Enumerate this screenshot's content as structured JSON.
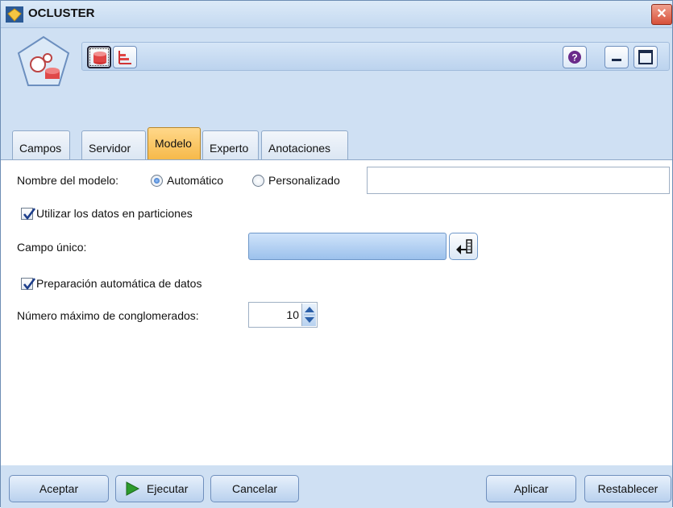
{
  "window": {
    "title": "OCLUSTER",
    "close_label": "✕"
  },
  "toolbar": {
    "buttons": [
      {
        "name": "data-source-icon",
        "selected": true
      },
      {
        "name": "chart-icon",
        "selected": false
      }
    ],
    "help_label": "?",
    "minimize_label": "",
    "maximize_label": ""
  },
  "tabs": [
    {
      "label": "Campos",
      "active": false
    },
    {
      "label": "Servidor",
      "active": false
    },
    {
      "label": "Modelo",
      "active": true
    },
    {
      "label": "Experto",
      "active": false
    },
    {
      "label": "Anotaciones",
      "active": false
    }
  ],
  "form": {
    "model_name_label": "Nombre del modelo:",
    "radio_auto": "Automático",
    "radio_custom": "Personalizado",
    "custom_name_value": "",
    "use_partitions_label": "Utilizar los datos en particiones",
    "unique_field_label": "Campo único:",
    "unique_field_value": "",
    "auto_prep_label": "Preparación automática de datos",
    "max_clusters_label": "Número máximo de conglomerados:",
    "max_clusters_value": "10"
  },
  "footer": {
    "accept": "Aceptar",
    "run": "Ejecutar",
    "cancel": "Cancelar",
    "apply": "Aplicar",
    "reset": "Restablecer"
  },
  "colors": {
    "window_bg": "#cfe0f3",
    "active_tab": "#f6b94a",
    "run_arrow": "#2d9b2d",
    "close": "#d7503a"
  }
}
